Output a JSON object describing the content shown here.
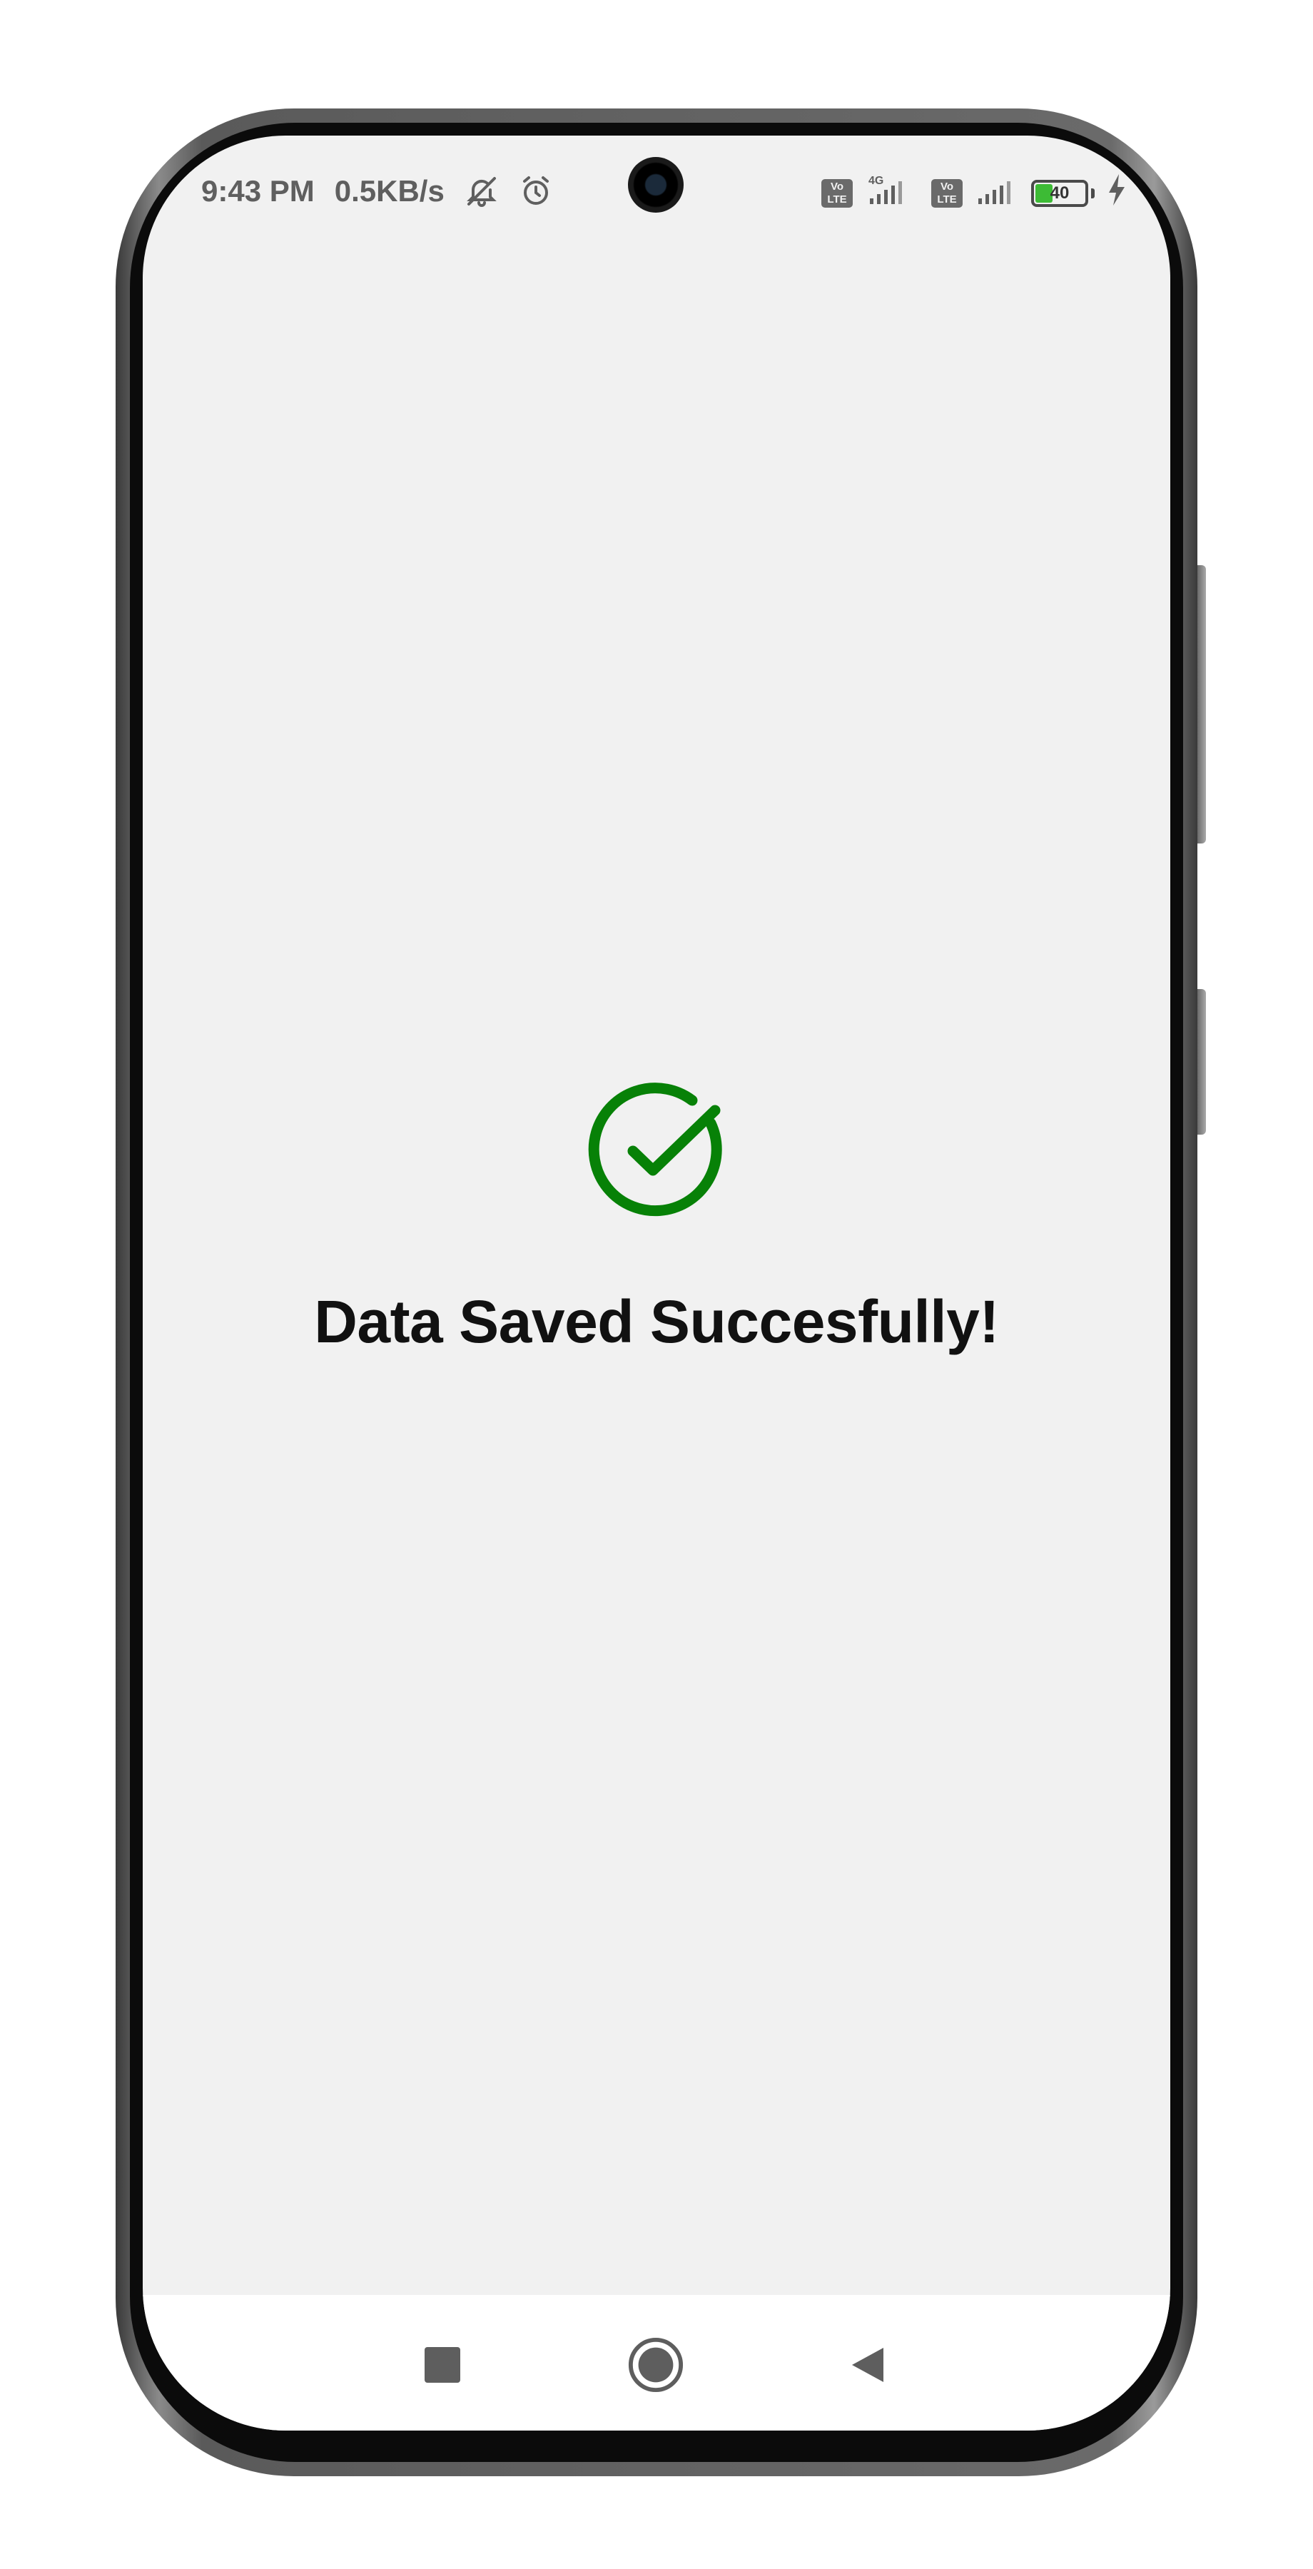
{
  "status_bar": {
    "time": "9:43 PM",
    "network_speed": "0.5KB/s",
    "left_icons": [
      "notifications-off-icon",
      "alarm-icon"
    ],
    "sim1_label": "Vo\nLTE",
    "sim1_network": "4G",
    "sim2_label": "Vo\nLTE",
    "battery_level": "40",
    "charging": true
  },
  "main": {
    "icon": "check-circle-icon",
    "message": "Data Saved Succesfully!"
  },
  "nav_bar": {
    "buttons": [
      "recent-apps",
      "home",
      "back"
    ]
  },
  "colors": {
    "success_green": "#078107",
    "background": "#f1f1f1",
    "text": "#111111",
    "status_text": "#5f5f5f"
  }
}
